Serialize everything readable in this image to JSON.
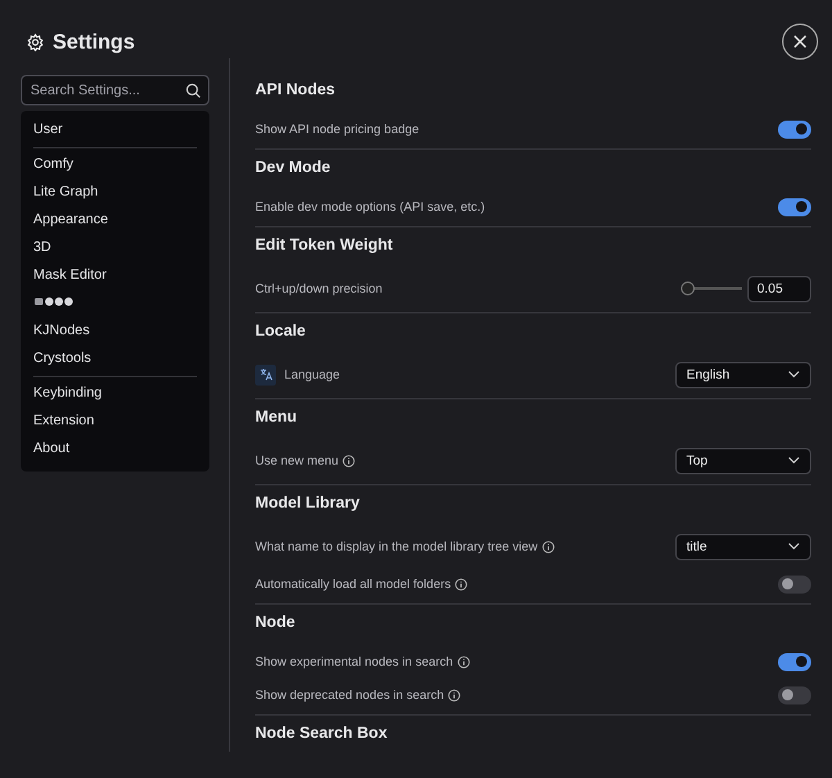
{
  "title": "Settings",
  "search": {
    "placeholder": "Search Settings..."
  },
  "sidebar": {
    "groups": [
      {
        "items": [
          {
            "kind": "text",
            "label": "User",
            "selected": false
          }
        ]
      },
      {
        "items": [
          {
            "kind": "text",
            "label": "Comfy",
            "selected": false
          },
          {
            "kind": "text",
            "label": "Lite Graph",
            "selected": false
          },
          {
            "kind": "text",
            "label": "Appearance",
            "selected": false
          },
          {
            "kind": "text",
            "label": "3D",
            "selected": false
          },
          {
            "kind": "text",
            "label": "Mask Editor",
            "selected": false
          },
          {
            "kind": "icons",
            "selected": false
          },
          {
            "kind": "text",
            "label": "KJNodes",
            "selected": false
          },
          {
            "kind": "text",
            "label": "Crystools",
            "selected": false
          }
        ]
      },
      {
        "items": [
          {
            "kind": "text",
            "label": "Keybinding",
            "selected": false
          },
          {
            "kind": "text",
            "label": "Extension",
            "selected": false
          },
          {
            "kind": "text",
            "label": "About",
            "selected": false
          }
        ]
      }
    ]
  },
  "sections": [
    {
      "title": "API Nodes",
      "settings": [
        {
          "kind": "toggle",
          "label": "Show API node pricing badge",
          "info": false,
          "on": true
        }
      ]
    },
    {
      "title": "Dev Mode",
      "settings": [
        {
          "kind": "toggle",
          "label": "Enable dev mode options (API save, etc.)",
          "info": false,
          "on": true
        }
      ]
    },
    {
      "title": "Edit Token Weight",
      "settings": [
        {
          "kind": "slider",
          "label": "Ctrl+up/down precision",
          "info": false,
          "level": 0,
          "value": "0.05"
        }
      ]
    },
    {
      "title": "Locale",
      "settings": [
        {
          "kind": "select",
          "label": "Language",
          "info": false,
          "language_icon": true,
          "value": "English"
        }
      ]
    },
    {
      "title": "Menu",
      "settings": [
        {
          "kind": "select",
          "label": "Use new menu",
          "info": true,
          "value": "Top"
        }
      ]
    },
    {
      "title": "Model Library",
      "settings": [
        {
          "kind": "select",
          "label": "What name to display in the model library tree view",
          "info": true,
          "value": "title"
        },
        {
          "kind": "toggle",
          "label": "Automatically load all model folders",
          "info": true,
          "on": false
        }
      ]
    },
    {
      "title": "Node",
      "settings": [
        {
          "kind": "toggle",
          "label": "Show experimental nodes in search",
          "info": true,
          "on": true
        },
        {
          "kind": "toggle",
          "label": "Show deprecated nodes in search",
          "info": true,
          "on": false
        }
      ]
    },
    {
      "title": "Node Search Box"
    }
  ]
}
